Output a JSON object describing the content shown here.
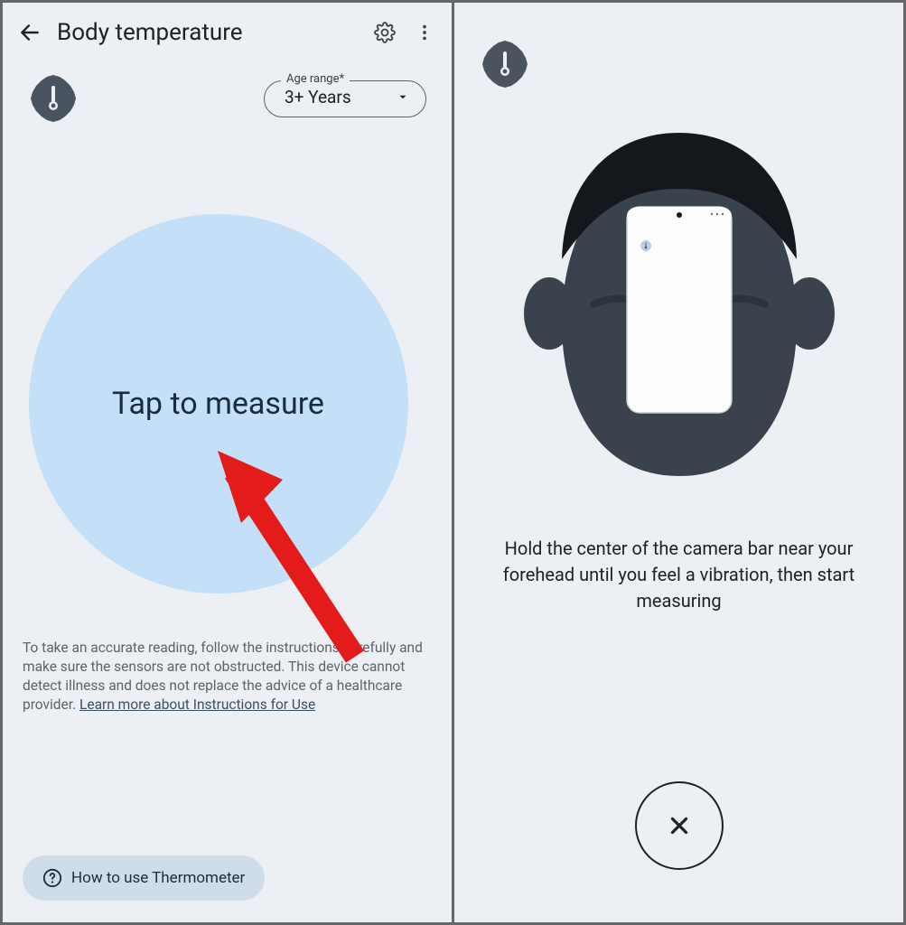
{
  "left": {
    "title": "Body temperature",
    "age_label": "Age range*",
    "age_value": "3+ Years",
    "tap_text": "Tap to measure",
    "disclaimer_text": "To take an accurate reading, follow the instructions carefully and make sure the sensors are not obstructed. This device cannot detect illness and does not replace the advice of a healthcare provider. ",
    "disclaimer_link": "Learn more about Instructions for Use",
    "howto_label": "How to use Thermometer"
  },
  "right": {
    "instruction": "Hold the center of the camera bar near your forehead until you feel a vibration, then start measuring"
  }
}
